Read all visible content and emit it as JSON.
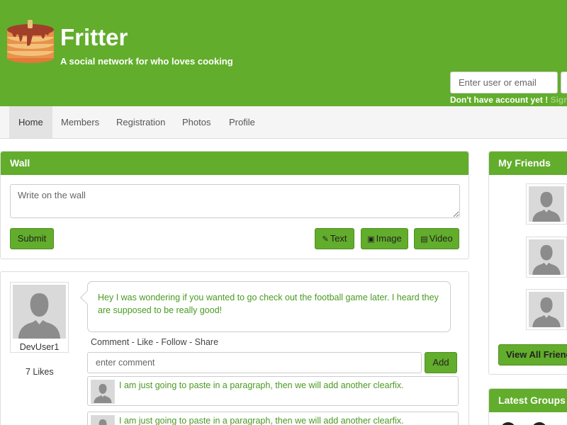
{
  "header": {
    "logo_icon": "pancake-stack-icon",
    "title": "Fritter",
    "tagline": "A social network for who loves cooking",
    "login_placeholder": "Enter user or email",
    "signup_prefix": "Don't have account yet !",
    "signup_link": "Sign",
    "brand_color": "#62ad2c"
  },
  "nav": {
    "items": [
      "Home",
      "Members",
      "Registration",
      "Photos",
      "Profile"
    ],
    "active": "Home"
  },
  "wall": {
    "heading": "Wall",
    "textarea_placeholder": "Write on the wall",
    "submit_label": "Submit",
    "text_label": "Text",
    "image_label": "Image",
    "video_label": "Video",
    "text_icon": "pencil-icon",
    "image_icon": "image-icon",
    "video_icon": "video-icon"
  },
  "post": {
    "author": "DevUser1",
    "likes": "7 Likes",
    "message": "Hey I was wondering if you wanted to go check out the football game later. I heard they are supposed to be really good!",
    "actions": {
      "comment": "Comment",
      "like": "Like",
      "follow": "Follow",
      "share": "Share",
      "separator": "-"
    },
    "comment_placeholder": "enter comment",
    "add_label": "Add",
    "comments": [
      {
        "text": "I am just going to paste in a paragraph, then we will add another clearfix."
      },
      {
        "text": "I am just going to paste in a paragraph, then we will add another clearfix."
      }
    ]
  },
  "friends": {
    "heading": "My Friends",
    "view_all_label": "View All Friends"
  },
  "groups": {
    "heading": "Latest Groups"
  }
}
